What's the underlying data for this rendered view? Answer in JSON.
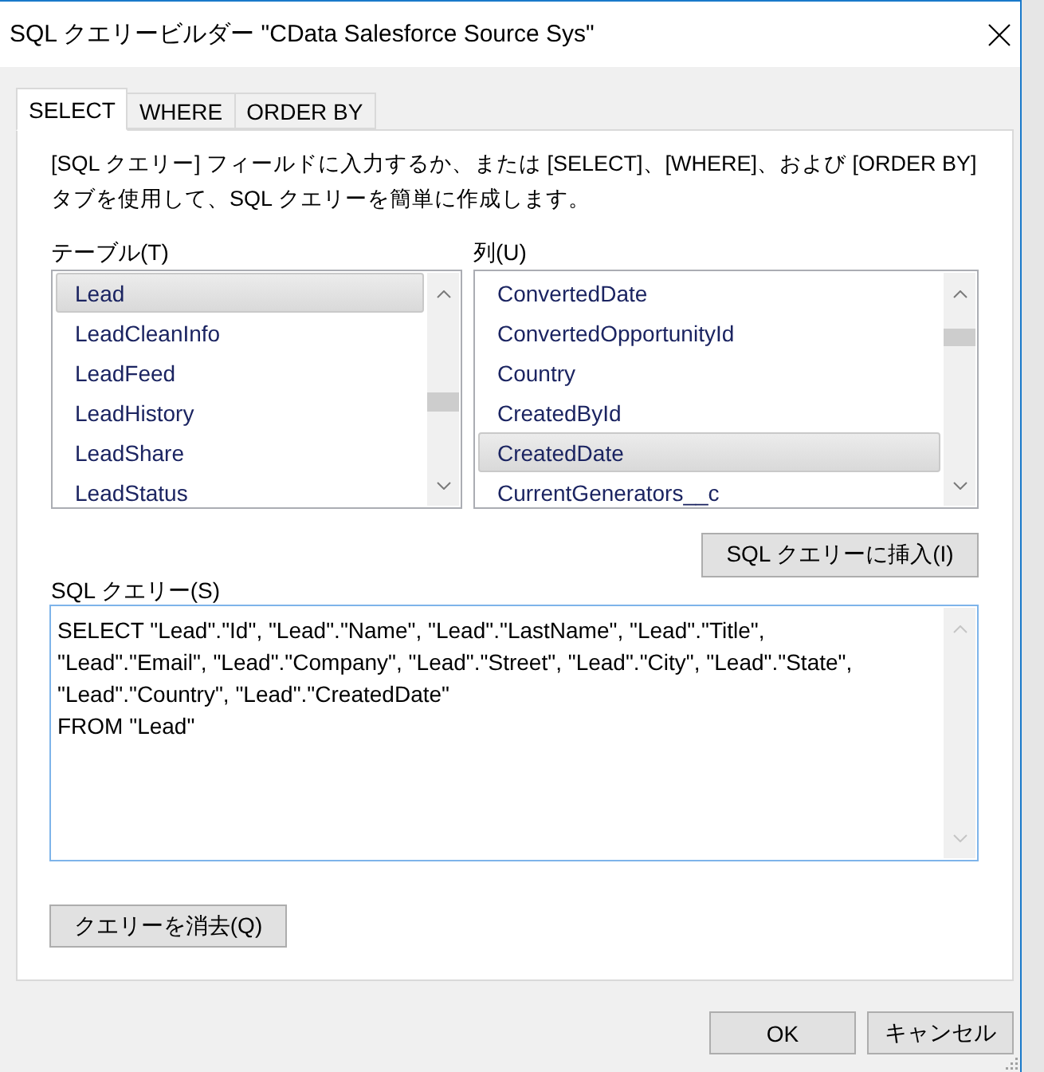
{
  "window": {
    "title": "SQL クエリービルダー \"CData Salesforce Source Sys\""
  },
  "tabs": [
    {
      "label": "SELECT",
      "selected": true
    },
    {
      "label": "WHERE",
      "selected": false
    },
    {
      "label": "ORDER BY",
      "selected": false
    }
  ],
  "description": "[SQL クエリー] フィールドに入力するか、または [SELECT]、[WHERE]、および [ORDER BY] タブを使用して、SQL クエリーを簡単に作成します。",
  "tables": {
    "label": "テーブル(T)",
    "items": [
      {
        "label": "Lead",
        "selected": true
      },
      {
        "label": "LeadCleanInfo",
        "selected": false
      },
      {
        "label": "LeadFeed",
        "selected": false
      },
      {
        "label": "LeadHistory",
        "selected": false
      },
      {
        "label": "LeadShare",
        "selected": false
      },
      {
        "label": "LeadStatus",
        "selected": false
      }
    ]
  },
  "columns": {
    "label": "列(U)",
    "items": [
      {
        "label": "ConvertedDate",
        "selected": false
      },
      {
        "label": "ConvertedOpportunityId",
        "selected": false
      },
      {
        "label": "Country",
        "selected": false
      },
      {
        "label": "CreatedById",
        "selected": false
      },
      {
        "label": "CreatedDate",
        "selected": true
      },
      {
        "label": "CurrentGenerators__c",
        "selected": false
      }
    ]
  },
  "insert_button": "SQL クエリーに挿入(I)",
  "query": {
    "label": "SQL クエリー(S)",
    "value": "SELECT \"Lead\".\"Id\", \"Lead\".\"Name\", \"Lead\".\"LastName\", \"Lead\".\"Title\",\n\"Lead\".\"Email\", \"Lead\".\"Company\", \"Lead\".\"Street\", \"Lead\".\"City\", \"Lead\".\"State\",\n\"Lead\".\"Country\", \"Lead\".\"CreatedDate\"\nFROM \"Lead\""
  },
  "clear_button": "クエリーを消去(Q)",
  "buttons": [
    "OK",
    "キャンセル"
  ]
}
